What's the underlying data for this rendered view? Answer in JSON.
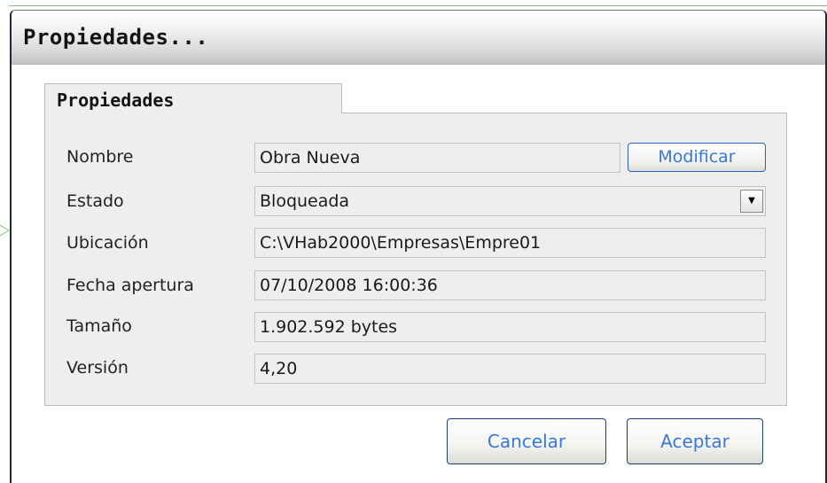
{
  "window": {
    "title": "Propiedades..."
  },
  "tab": {
    "label": "Propiedades"
  },
  "fields": {
    "nombre": {
      "label": "Nombre",
      "value": "Obra Nueva"
    },
    "estado": {
      "label": "Estado",
      "value": "Bloqueada"
    },
    "ubicacion": {
      "label": "Ubicación",
      "value": "C:\\VHab2000\\Empresas\\Empre01"
    },
    "fecha_apertura": {
      "label": "Fecha apertura",
      "value": "07/10/2008 16:00:36"
    },
    "tamano": {
      "label": "Tamaño",
      "value": "1.902.592 bytes"
    },
    "version": {
      "label": "Versión",
      "value": "4,20"
    }
  },
  "buttons": {
    "modificar": "Modificar",
    "cancelar": "Cancelar",
    "aceptar": "Aceptar"
  },
  "icons": {
    "dropdown": "chevron-down-icon"
  },
  "colors": {
    "button_text": "#3a78d8",
    "button_border": "#1d3f7a",
    "panel_bg": "#eeeeee",
    "outer_line": "#7fc07f"
  }
}
